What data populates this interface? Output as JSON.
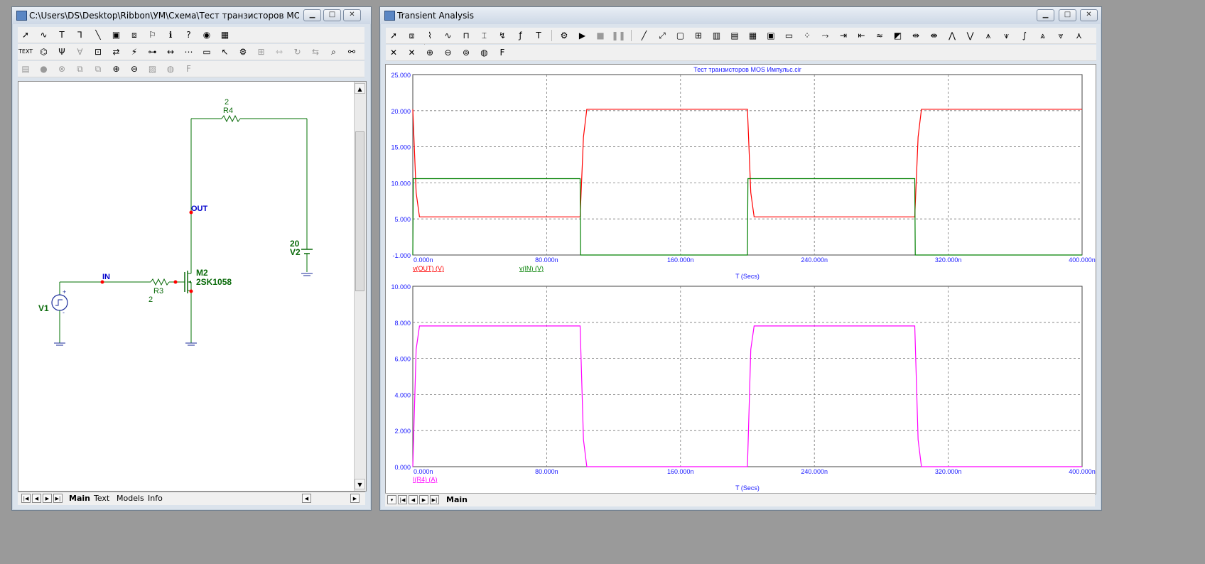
{
  "left_window": {
    "title": "C:\\Users\\DS\\Desktop\\Ribbon\\УМ\\Схема\\Тест транзисторов MOS Импул...",
    "tabs": [
      "Main",
      "Text",
      "Models",
      "Info"
    ],
    "active_tab": "Main"
  },
  "schematic": {
    "r4_value": "2",
    "r4_name": "R4",
    "out_label": "OUT",
    "in_label": "IN",
    "r3_name": "R3",
    "r3_value": "2",
    "m2_name": "M2",
    "m2_model": "2SK1058",
    "v1_name": "V1",
    "v2_value": "20",
    "v2_name": "V2",
    "colors": {
      "wire": "#007000",
      "component": "#0a6a0a",
      "label_blue": "#0000cc",
      "node": "#ff0000",
      "ground": "#1a2a9a"
    }
  },
  "right_window": {
    "title": "Transient Analysis",
    "tabs": [
      "Main"
    ],
    "active_tab": "Main"
  },
  "chart_data": [
    {
      "type": "line",
      "title": "Тест транзисторов MOS Импульс.cir",
      "xlabel": "T (Secs)",
      "ylabel": "",
      "xlim": [
        0,
        400
      ],
      "ylim": [
        -1,
        25
      ],
      "x_ticks": [
        "0.000n",
        "80.000n",
        "160.000n",
        "240.000n",
        "320.000n",
        "400.000n"
      ],
      "y_ticks": [
        "-1.000",
        "5.000",
        "10.000",
        "15.000",
        "20.000",
        "25.000"
      ],
      "grid": true,
      "legend_position": "bottom-left",
      "series": [
        {
          "name": "v(OUT) (V)",
          "color": "#ff0000",
          "x": [
            0,
            2,
            4,
            100,
            102,
            104,
            200,
            202,
            204,
            300,
            302,
            304,
            400
          ],
          "y": [
            20,
            8,
            4.5,
            4.5,
            16,
            20,
            20,
            8,
            4.5,
            4.5,
            16,
            20,
            20
          ]
        },
        {
          "name": "v(IN) (V)",
          "color": "#008000",
          "x": [
            0,
            0.3,
            100,
            100.3,
            200,
            200.3,
            300,
            300.3,
            400
          ],
          "y": [
            -1,
            10,
            10,
            -1,
            -1,
            10,
            10,
            -1,
            -1
          ]
        }
      ]
    },
    {
      "type": "line",
      "title": "",
      "xlabel": "T (Secs)",
      "ylabel": "",
      "xlim": [
        0,
        400
      ],
      "ylim": [
        0,
        10
      ],
      "x_ticks": [
        "0.000n",
        "80.000n",
        "160.000n",
        "240.000n",
        "320.000n",
        "400.000n"
      ],
      "y_ticks": [
        "0.000",
        "2.000",
        "4.000",
        "6.000",
        "8.000",
        "10.000"
      ],
      "grid": true,
      "legend_position": "bottom-left",
      "series": [
        {
          "name": "I(R4) (A)",
          "color": "#ff00ff",
          "x": [
            0,
            2,
            4,
            100,
            102,
            104,
            200,
            202,
            204,
            300,
            302,
            304,
            400
          ],
          "y": [
            0,
            6.5,
            7.8,
            7.8,
            1.5,
            0,
            0,
            6.5,
            7.8,
            7.8,
            1.5,
            0,
            0
          ]
        }
      ]
    }
  ]
}
